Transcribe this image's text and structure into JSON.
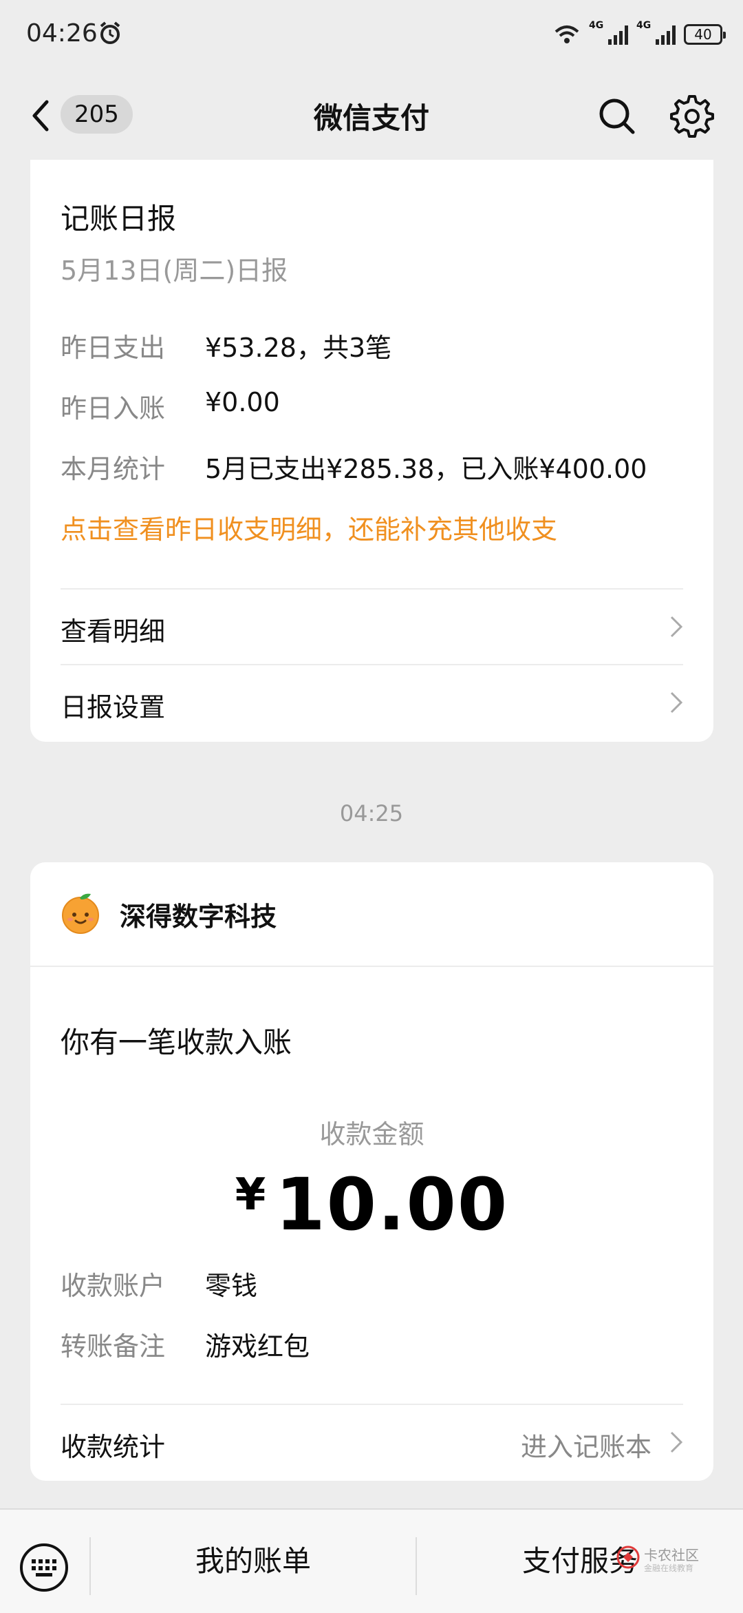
{
  "status_bar": {
    "time": "04:26",
    "network_1": "4G",
    "network_2": "4G",
    "battery": "40"
  },
  "nav": {
    "unread_count": "205",
    "title": "微信支付"
  },
  "daily_report": {
    "title": "记账日报",
    "subtitle": "5月13日(周二)日报",
    "rows": [
      {
        "label": "昨日支出",
        "value": "¥53.28，共3笔"
      },
      {
        "label": "昨日入账",
        "value": "¥0.00"
      },
      {
        "label": "本月统计",
        "value": "5月已支出¥285.38，已入账¥400.00"
      }
    ],
    "hint": "点击查看昨日收支明细，还能补充其他收支",
    "links": [
      {
        "label": "查看明细"
      },
      {
        "label": "日报设置"
      }
    ]
  },
  "timestamp": "04:25",
  "payment_notice": {
    "merchant": "深得数字科技",
    "title": "你有一笔收款入账",
    "amount_label": "收款金额",
    "currency": "¥",
    "amount": "10.00",
    "details": [
      {
        "label": "收款账户",
        "value": "零钱"
      },
      {
        "label": "转账备注",
        "value": "游戏红包"
      }
    ],
    "footer_label": "收款统计",
    "footer_link": "进入记账本"
  },
  "bottom_bar": {
    "item_1": "我的账单",
    "item_2": "支付服务"
  },
  "watermark": {
    "name": "卡农社区",
    "tagline": "金融在线教育"
  },
  "colors": {
    "accent_orange": "#f09020",
    "background": "#ededed"
  }
}
